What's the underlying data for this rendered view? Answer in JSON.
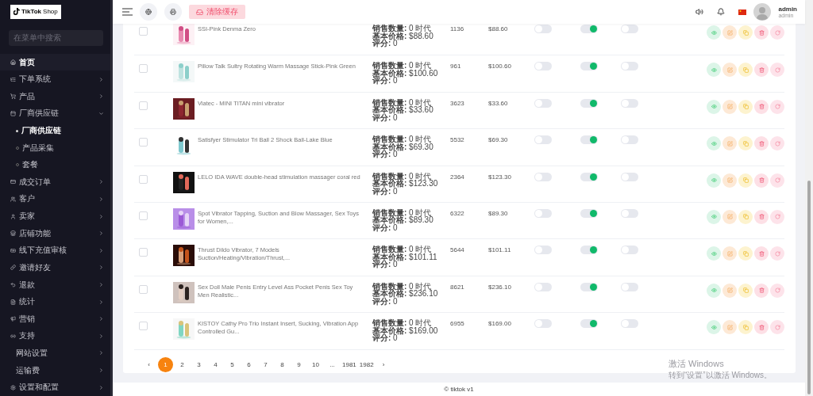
{
  "sidebar": {
    "logo": {
      "brand": "TikTok",
      "suffix": "Shop"
    },
    "search": {
      "placeholder": "在菜单中搜索"
    },
    "items": [
      {
        "label": "首页",
        "selected": true
      },
      {
        "label": "下单系统",
        "selected": false,
        "expanded": false
      },
      {
        "label": "产品",
        "selected": false,
        "expanded": false
      },
      {
        "label": "厂商供应链",
        "selected": false,
        "expanded": true,
        "children": [
          {
            "label": "厂商供应链",
            "selected": true
          },
          {
            "label": "产品采集",
            "selected": false
          },
          {
            "label": "套餐",
            "selected": false
          }
        ]
      },
      {
        "label": "成交订单",
        "selected": false,
        "expanded": false
      },
      {
        "label": "客户",
        "selected": false,
        "expanded": false
      },
      {
        "label": "卖家",
        "selected": false,
        "expanded": false
      },
      {
        "label": "店铺功能",
        "selected": false,
        "expanded": false
      },
      {
        "label": "线下充值审核",
        "selected": false,
        "expanded": false
      },
      {
        "label": "邀请好友",
        "selected": false,
        "expanded": false
      },
      {
        "label": "退款",
        "selected": false,
        "expanded": false
      },
      {
        "label": "统计",
        "selected": false,
        "expanded": false
      },
      {
        "label": "营销",
        "selected": false,
        "expanded": false
      },
      {
        "label": "支持",
        "selected": false,
        "expanded": false
      },
      {
        "label": "网站设置",
        "selected": false,
        "expanded": false
      },
      {
        "label": "运输费",
        "selected": false,
        "expanded": false
      },
      {
        "label": "设置和配置",
        "selected": false,
        "expanded": false
      }
    ]
  },
  "header": {
    "clear_cache_button": "清除缓存",
    "user": {
      "name": "admin",
      "role": "admin"
    }
  },
  "products": [
    {
      "checked": false,
      "name": "SSI-Pink Denma Zero",
      "sales": "**销售数量:** 0 时代",
      "base_price": "**基本价格:** $88.60",
      "rating": "**评分:** 0",
      "id": "1136",
      "price": "$88.60",
      "toggle_1": false,
      "toggle_2": true,
      "toggle_3": false
    },
    {
      "checked": false,
      "name": "Pillow Talk Sultry Rotating Warm Massage Stick-Pink Green",
      "sales": "**销售数量:** 0 时代",
      "base_price": "**基本价格:** $100.60",
      "rating": "**评分:** 0",
      "id": "961",
      "price": "$100.60",
      "toggle_1": false,
      "toggle_2": true,
      "toggle_3": false
    },
    {
      "checked": false,
      "name": "Viatec - MINI TITAN mini vibrator",
      "sales": "**销售数量:** 0 时代",
      "base_price": "**基本价格:** $33.60",
      "rating": "**评分:** 0",
      "id": "3623",
      "price": "$33.60",
      "toggle_1": false,
      "toggle_2": true,
      "toggle_3": false
    },
    {
      "checked": false,
      "name": "Satisfyer Stimulator Tri Ball 2 Shock Ball-Lake Blue",
      "sales": "**销售数量:** 0 时代",
      "base_price": "**基本价格:** $69.30",
      "rating": "**评分:** 0",
      "id": "5532",
      "price": "$69.30",
      "toggle_1": false,
      "toggle_2": true,
      "toggle_3": false
    },
    {
      "checked": false,
      "name": "LELO IDA WAVE double-head stimulation massager coral red",
      "sales": "**销售数量:** 0 时代",
      "base_price": "**基本价格:** $123.30",
      "rating": "**评分:** 0",
      "id": "2364",
      "price": "$123.30",
      "toggle_1": false,
      "toggle_2": true,
      "toggle_3": false
    },
    {
      "checked": false,
      "name": "Spot Vibrator Tapping, Suction and Blow Massager, Sex Toys for Women,...",
      "sales": "**销售数量:** 0 时代",
      "base_price": "**基本价格:** $89.30",
      "rating": "**评分:** 0",
      "id": "6322",
      "price": "$89.30",
      "toggle_1": false,
      "toggle_2": true,
      "toggle_3": false
    },
    {
      "checked": false,
      "name": "Thrust Dildo Vibrator, 7 Models Suction/Heating/Vibration/Thrust,...",
      "sales": "**销售数量:** 0 时代",
      "base_price": "**基本价格:** $101.11",
      "rating": "**评分:** 0",
      "id": "5644",
      "price": "$101.11",
      "toggle_1": false,
      "toggle_2": true,
      "toggle_3": false
    },
    {
      "checked": false,
      "name": "Sex Doll Male Penis Entry Level Ass Pocket Penis Sex Toy Men Realistic...",
      "sales": "**销售数量:** 0 时代",
      "base_price": "**基本价格:** $236.10",
      "rating": "**评分:** 0",
      "id": "8621",
      "price": "$236.10",
      "toggle_1": false,
      "toggle_2": true,
      "toggle_3": false
    },
    {
      "checked": false,
      "name": "KISTOY Cathy Pro Trio Instant Insert, Sucking, Vibration App Controlled Gu...",
      "sales": "**销售数量:** 0 时代",
      "base_price": "**基本价格:** $169.00",
      "rating": "**评分:** 0",
      "id": "6955",
      "price": "$169.00",
      "toggle_1": false,
      "toggle_2": true,
      "toggle_3": false
    }
  ],
  "pagination": {
    "prev": "‹",
    "next": "›",
    "pages": [
      {
        "label": "1",
        "selected": true
      },
      {
        "label": "2",
        "selected": false
      },
      {
        "label": "3",
        "selected": false
      },
      {
        "label": "4",
        "selected": false
      },
      {
        "label": "5",
        "selected": false
      },
      {
        "label": "6",
        "selected": false
      },
      {
        "label": "7",
        "selected": false
      },
      {
        "label": "8",
        "selected": false
      },
      {
        "label": "9",
        "selected": false
      },
      {
        "label": "10",
        "selected": false
      },
      {
        "label": "...",
        "selected": false
      },
      {
        "label": "1981",
        "selected": false
      },
      {
        "label": "1982",
        "selected": false
      }
    ]
  },
  "footer": "© tiktok v1",
  "os_notice": {
    "title": "激活 Windows",
    "hint": "转到“设置”以激活 Windows。"
  }
}
